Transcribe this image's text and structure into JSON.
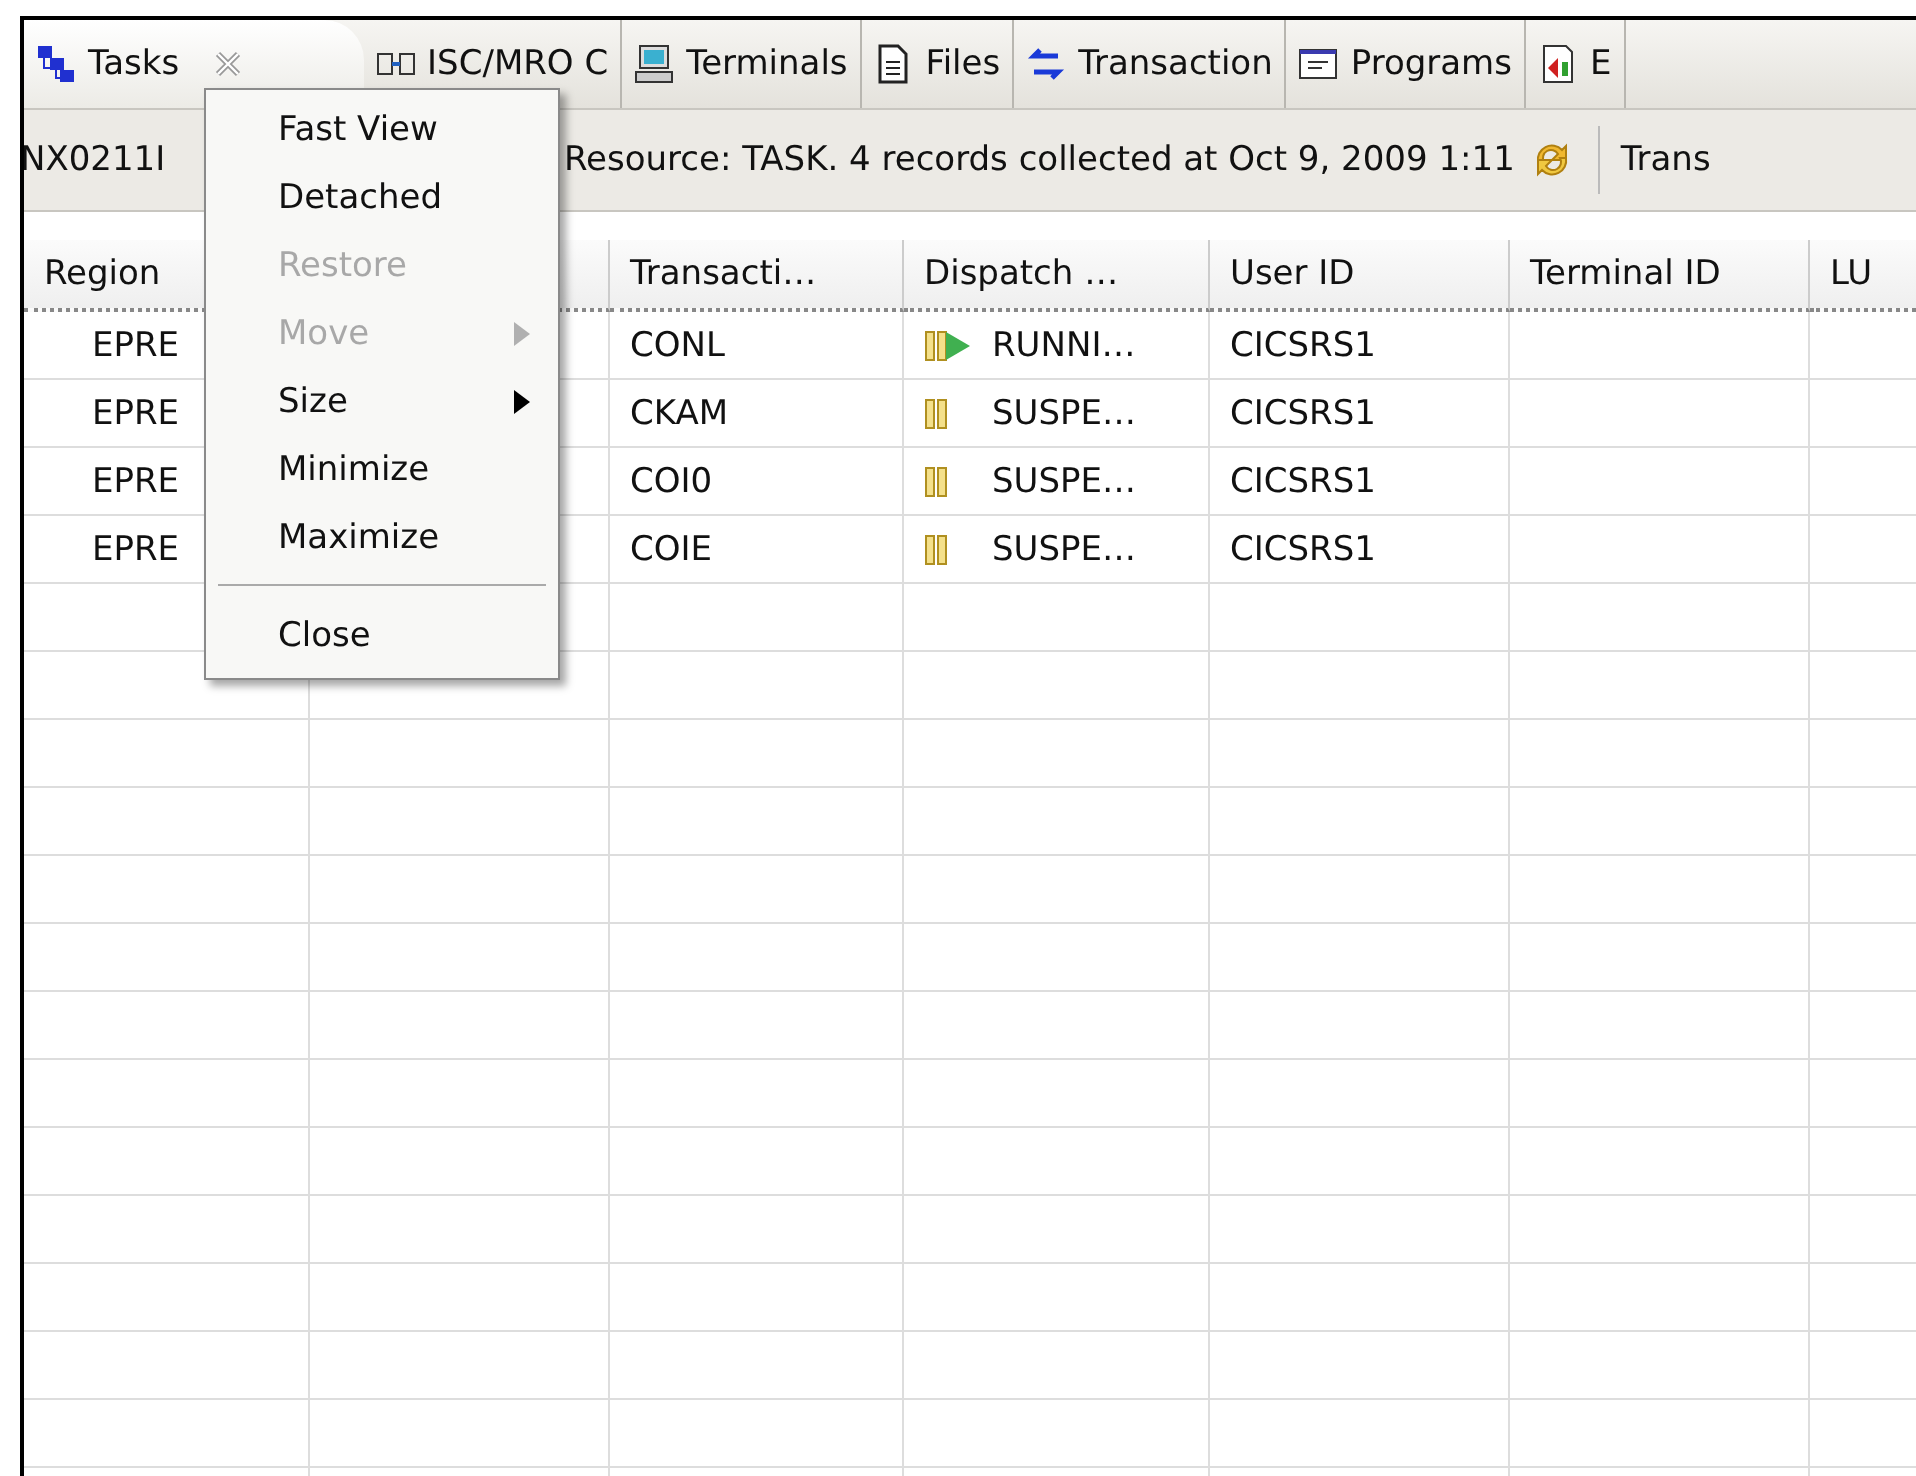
{
  "tabs": [
    {
      "label": "Tasks",
      "kind": "tasks",
      "selected": true,
      "closable": true
    },
    {
      "label": "ISC/MRO C",
      "kind": "link",
      "selected": false,
      "closable": false
    },
    {
      "label": "Terminals",
      "kind": "terminal",
      "selected": false,
      "closable": false
    },
    {
      "label": "Files",
      "kind": "file",
      "selected": false,
      "closable": false
    },
    {
      "label": "Transaction",
      "kind": "transaction",
      "selected": false,
      "closable": false
    },
    {
      "label": "Programs",
      "kind": "program",
      "selected": false,
      "closable": false
    },
    {
      "label": "E",
      "kind": "chart",
      "selected": false,
      "closable": false
    }
  ],
  "toolbar": {
    "message_id": "NX0211I",
    "status": "Resource: TASK. 4 records collected at Oct 9, 2009 1:11",
    "filter_label": "Trans"
  },
  "table": {
    "columns": [
      "Region",
      "",
      "Transacti…",
      "Dispatch …",
      "User ID",
      "Terminal ID",
      "LU"
    ],
    "rows": [
      {
        "region": "EPRE",
        "transaction": "CONL",
        "dispatch": "RUNNI…",
        "kind": "running",
        "user_id": "CICSRS1"
      },
      {
        "region": "EPRE",
        "transaction": "CKAM",
        "dispatch": "SUSPE…",
        "kind": "suspended",
        "user_id": "CICSRS1"
      },
      {
        "region": "EPRE",
        "transaction": "COI0",
        "dispatch": "SUSPE…",
        "kind": "suspended",
        "user_id": "CICSRS1"
      },
      {
        "region": "EPRE",
        "transaction": "COIE",
        "dispatch": "SUSPE…",
        "kind": "suspended",
        "user_id": "CICSRS1"
      }
    ]
  },
  "context_menu": {
    "items": [
      {
        "label": "Fast View",
        "disabled": false,
        "submenu": false,
        "separator_before": false
      },
      {
        "label": "Detached",
        "disabled": false,
        "submenu": false,
        "separator_before": false
      },
      {
        "label": "Restore",
        "disabled": true,
        "submenu": false,
        "separator_before": false
      },
      {
        "label": "Move",
        "disabled": true,
        "submenu": true,
        "separator_before": false
      },
      {
        "label": "Size",
        "disabled": false,
        "submenu": true,
        "separator_before": false
      },
      {
        "label": "Minimize",
        "disabled": false,
        "submenu": false,
        "separator_before": false
      },
      {
        "label": "Maximize",
        "disabled": false,
        "submenu": false,
        "separator_before": false
      },
      {
        "label": "Close",
        "disabled": false,
        "submenu": false,
        "separator_before": true
      }
    ]
  }
}
